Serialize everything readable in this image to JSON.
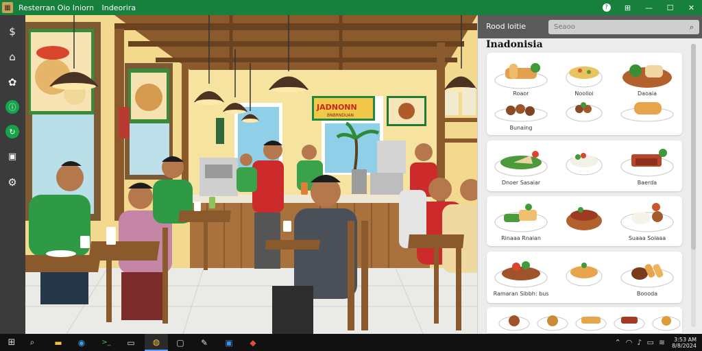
{
  "window": {
    "title_parts": [
      "Resterran Oio Iniorn",
      "Indeorira"
    ],
    "controls": {
      "help": "?",
      "pin": "⊞",
      "minimize": "—",
      "maximize": "☐",
      "close": "✕"
    }
  },
  "sidebar": {
    "items": [
      {
        "icon": "dollar-icon",
        "glyph": "$"
      },
      {
        "icon": "home-icon",
        "glyph": "⌂"
      },
      {
        "icon": "settings-icon",
        "glyph": "✿"
      },
      {
        "icon": "info-icon",
        "glyph": "ⓘ"
      },
      {
        "icon": "refresh-icon",
        "glyph": "↻"
      },
      {
        "icon": "lock-icon",
        "glyph": "🔒"
      },
      {
        "icon": "gear-icon",
        "glyph": "⚙"
      }
    ]
  },
  "panel": {
    "title": "Rood loitie",
    "search_placeholder": "Seaoo",
    "section_title": "Inadonisia",
    "cards": [
      {
        "rows": [
          [
            "Roaor",
            "Noolioi",
            "Daoaia"
          ],
          [
            "Bunaing",
            "",
            ""
          ]
        ]
      },
      {
        "rows": [
          [
            "Dnoer Sasaiar",
            "",
            "Baerda"
          ]
        ]
      },
      {
        "rows": [
          [
            "Rinaaa Rnaian",
            "",
            "Suaaa Soiaaa"
          ]
        ]
      },
      {
        "rows": [
          [
            "Ramaran Sibbh: bus",
            "",
            "Boooda"
          ]
        ]
      },
      {
        "rows": [
          [
            "",
            "",
            ""
          ]
        ]
      }
    ]
  },
  "scene": {
    "banner_text": "JADNONN",
    "banner_subtext": "BNBRNDUAN"
  },
  "colors": {
    "titlebar": "#17803c",
    "sidebar": "#3b3b3b",
    "panel_header": "#5a5a5a",
    "taskbar": "#111111"
  },
  "taskbar": {
    "items": [
      "windows-icon",
      "search-icon",
      "file-explorer-icon",
      "edge-icon",
      "terminal-icon",
      "store-icon",
      "chrome-icon",
      "window-icon",
      "pen-icon",
      "media-icon",
      "app-icon"
    ],
    "clock_time": "3:53 AM",
    "clock_date": "8/8/2024"
  }
}
